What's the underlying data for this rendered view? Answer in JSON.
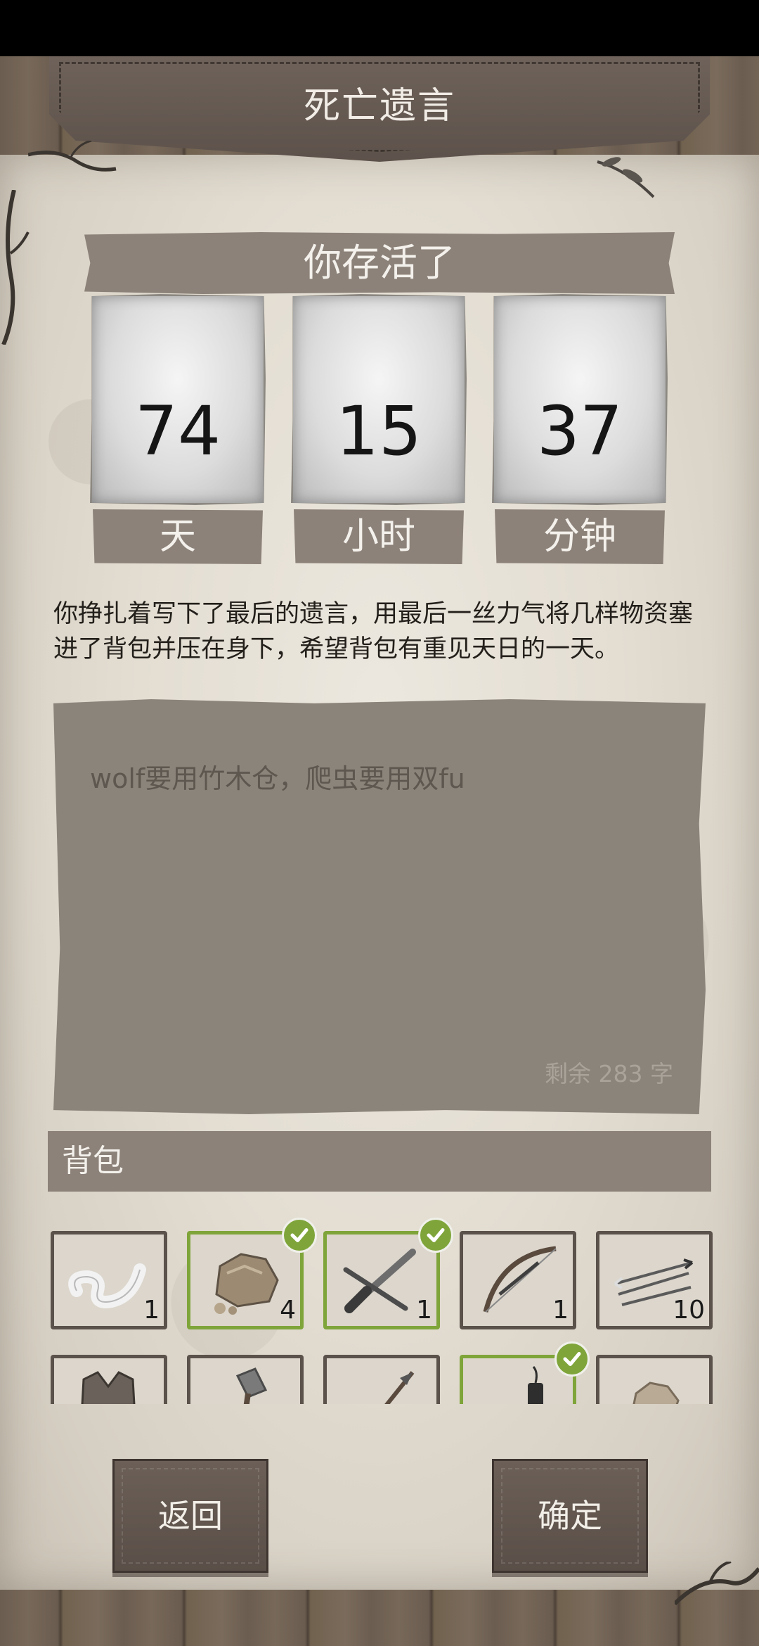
{
  "header": {
    "title": "死亡遗言"
  },
  "survived": {
    "label": "你存活了",
    "days": {
      "value": "74",
      "unit": "天"
    },
    "hours": {
      "value": "15",
      "unit": "小时"
    },
    "minutes": {
      "value": "37",
      "unit": "分钟"
    }
  },
  "description": "你挣扎着写下了最后的遗言，用最后一丝力气将几样物资塞进了背包并压在身下，希望背包有重见天日的一天。",
  "last_words": {
    "text": "wolf要用竹木仓，爬虫要用双fu",
    "remaining": "剩余 283 字"
  },
  "backpack": {
    "label": "背包",
    "items": [
      {
        "icon": "bandage-icon",
        "count": "1",
        "selected": false
      },
      {
        "icon": "stone-icon",
        "count": "4",
        "selected": true
      },
      {
        "icon": "crossbow-icon",
        "count": "1",
        "selected": true
      },
      {
        "icon": "bow-icon",
        "count": "1",
        "selected": false
      },
      {
        "icon": "arrows-icon",
        "count": "10",
        "selected": false
      },
      {
        "icon": "vest-icon",
        "count": "",
        "selected": false
      },
      {
        "icon": "axe-icon",
        "count": "",
        "selected": false
      },
      {
        "icon": "spear-icon",
        "count": "",
        "selected": false
      },
      {
        "icon": "dynamite-icon",
        "count": "",
        "selected": true
      },
      {
        "icon": "hide-icon",
        "count": "",
        "selected": false
      }
    ]
  },
  "buttons": {
    "back": "返回",
    "confirm": "确定"
  },
  "colors": {
    "selected": "#7fa53a",
    "banner": "#8c8279",
    "header": "#5d524b"
  }
}
